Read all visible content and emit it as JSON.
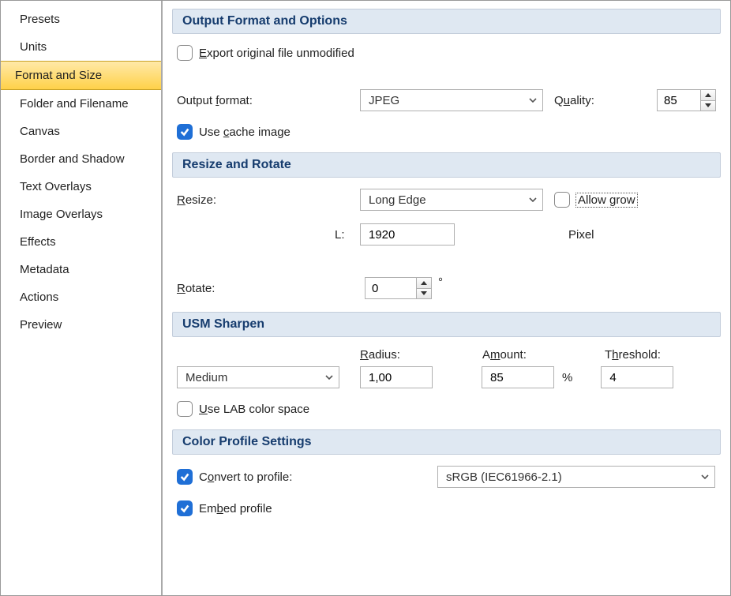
{
  "sidebar": {
    "items": [
      {
        "label": "Presets"
      },
      {
        "label": "Units"
      },
      {
        "label": "Format and Size",
        "selected": true
      },
      {
        "label": "Folder and Filename"
      },
      {
        "label": "Canvas"
      },
      {
        "label": "Border and Shadow"
      },
      {
        "label": "Text Overlays"
      },
      {
        "label": "Image Overlays"
      },
      {
        "label": "Effects"
      },
      {
        "label": "Metadata"
      },
      {
        "label": "Actions"
      },
      {
        "label": "Preview"
      }
    ]
  },
  "sections": {
    "output": {
      "title": "Output Format and Options",
      "export_original_label": "xport original file unmodified",
      "export_original_prefix": "E",
      "output_format_prefix": "Output ",
      "output_format_uchar": "f",
      "output_format_suffix": "ormat:",
      "format_value": "JPEG",
      "quality_prefix": "Q",
      "quality_uchar": "u",
      "quality_suffix": "ality:",
      "quality_value": "85",
      "use_cache_prefix": "Use ",
      "use_cache_uchar": "c",
      "use_cache_suffix": "ache image"
    },
    "resize": {
      "title": "Resize and Rotate",
      "resize_uchar": "R",
      "resize_suffix": "esize:",
      "resize_mode": "Long Edge",
      "allow_grow_prefix": "Allow ",
      "allow_grow_uchar": "g",
      "allow_grow_suffix": "row",
      "side_label": "L:",
      "side_value": "1920",
      "unit_label": "Pixel",
      "rotate_uchar": "R",
      "rotate_suffix": "otate:",
      "rotate_value": "0",
      "degree_symbol": "°"
    },
    "usm": {
      "title": "USM Sharpen",
      "preset_value": "Medium",
      "radius_uchar": "R",
      "radius_suffix": "adius:",
      "radius_value": "1,00",
      "amount_prefix": "A",
      "amount_uchar": "m",
      "amount_suffix": "ount:",
      "amount_value": "85",
      "percent": "%",
      "threshold_prefix": "T",
      "threshold_uchar": "h",
      "threshold_suffix": "reshold:",
      "threshold_value": "4",
      "use_lab_uchar": "U",
      "use_lab_suffix": "se LAB color space"
    },
    "color": {
      "title": "Color Profile Settings",
      "convert_prefix": "C",
      "convert_uchar": "o",
      "convert_suffix": "nvert to profile:",
      "profile_value": "sRGB (IEC61966-2.1)",
      "embed_prefix": "Em",
      "embed_uchar": "b",
      "embed_suffix": "ed profile"
    }
  }
}
